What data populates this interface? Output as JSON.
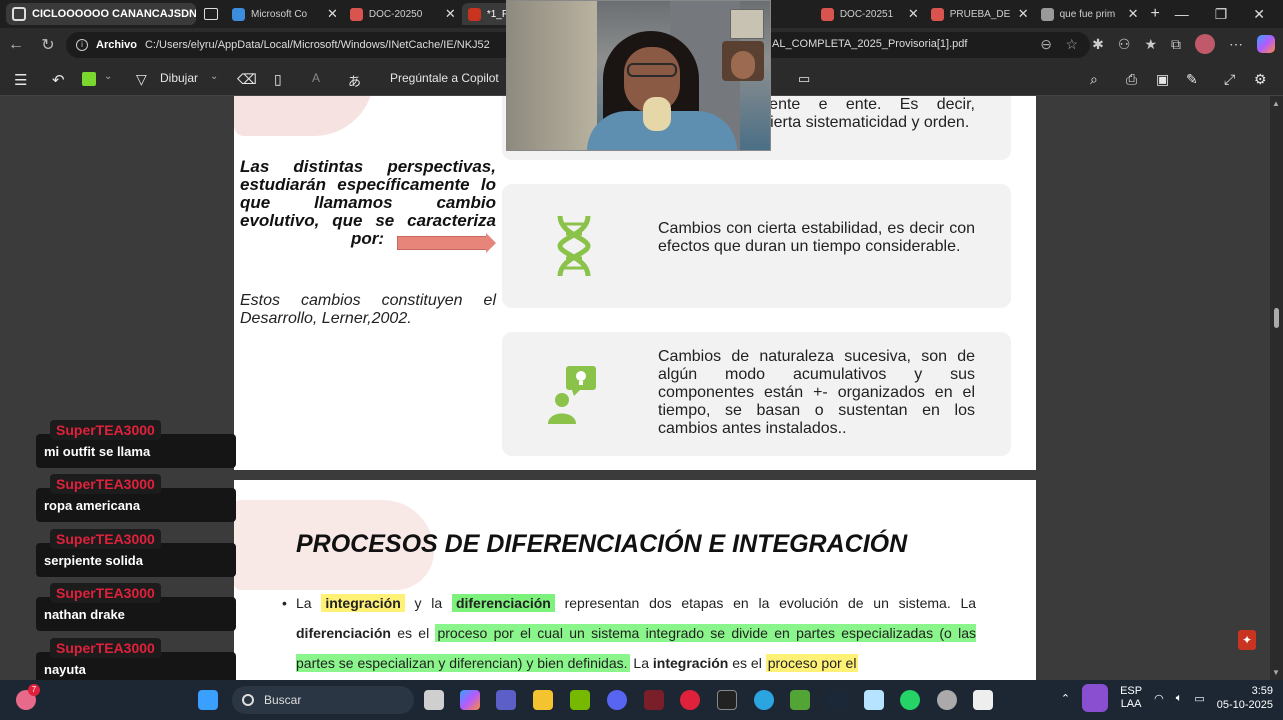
{
  "browser": {
    "workspace_label": "CICLOOOOOO CANANCAJSDNA",
    "tabs": [
      {
        "title": "Microsoft Co",
        "fav": "#3c8dde"
      },
      {
        "title": "DOC-20250",
        "fav": "#d9534f"
      },
      {
        "title": "*1_PRI",
        "fav": "#c8341f"
      },
      {
        "title": "DOC-20251",
        "fav": "#d9534f"
      },
      {
        "title": "PRUEBA_DE",
        "fav": "#d9534f"
      },
      {
        "title": "que fue prim",
        "fav": "#999999"
      }
    ],
    "new_tab": "+",
    "address": {
      "prefix": "Archivo",
      "url": "C:/Users/elyru/AppData/Local/Microsoft/Windows/INetCache/IE/NKJ52",
      "url_tail": "AL_COMPLETA_2025_Provisoria[1].pdf"
    }
  },
  "pdf_toolbar": {
    "draw_label": "Dibujar",
    "ask_copilot": "Pregúntale a Copilot",
    "read_aloud": "A"
  },
  "page1": {
    "left_bold": "Las distintas perspectivas, estudiarán específicamente lo que llamamos cambio evolutivo, que se caracteriza",
    "left_bold_last": "por:",
    "left_italic": "Estos cambios constituyen el Desarrollo, Lerner,2002.",
    "card1_text": "interindividualmente e ente. Es decir, hablamos con cierta sistematicidad y orden.",
    "card2_text": "Cambios con cierta estabilidad, es decir con efectos que duran un tiempo considerable.",
    "card3_text": "Cambios de naturaleza sucesiva, son de algún modo acumulativos y sus componentes están +- organizados en el tiempo, se basan o sustentan en los cambios antes instalados.."
  },
  "page2": {
    "heading": "PROCESOS DE DIFERENCIACIÓN E INTEGRACIÓN",
    "p_la": "La",
    "p_integracion": "integración",
    "p_y_la": "y la",
    "p_diferenciacion": "diferenciación",
    "p_rest1": "representan dos etapas en la evolución de un sistema. La",
    "p_diferenciacion2": "diferenciación",
    "p_es_el": "es el",
    "p_hl_green": "proceso por el cual un sistema integrado se divide en partes especializadas (o las partes se especializan y diferencian) y bien definidas.",
    "p_la2": "La",
    "p_integracion2": "integración",
    "p_es_el2": "es el",
    "p_hl_yellow": "proceso por el"
  },
  "chat": [
    {
      "user": "SuperTEA3000",
      "message": "mi outfit se llama"
    },
    {
      "user": "SuperTEA3000",
      "message": "ropa americana"
    },
    {
      "user": "SuperTEA3000",
      "message": "serpiente solida"
    },
    {
      "user": "SuperTEA3000",
      "message": "nathan drake"
    },
    {
      "user": "SuperTEA3000",
      "message": "nayuta"
    }
  ],
  "taskbar": {
    "search_label": "Buscar",
    "lang_top": "ESP",
    "lang_bottom": "LAA",
    "time": "3:59",
    "date": "05-10-2025",
    "notification_badge": "7"
  },
  "colors": {
    "highlight_yellow": "#fff176",
    "highlight_green": "#7cf27c",
    "icon_green": "#8bc34a",
    "arrow": "#e8857a",
    "chat_user": "#e0213c"
  }
}
